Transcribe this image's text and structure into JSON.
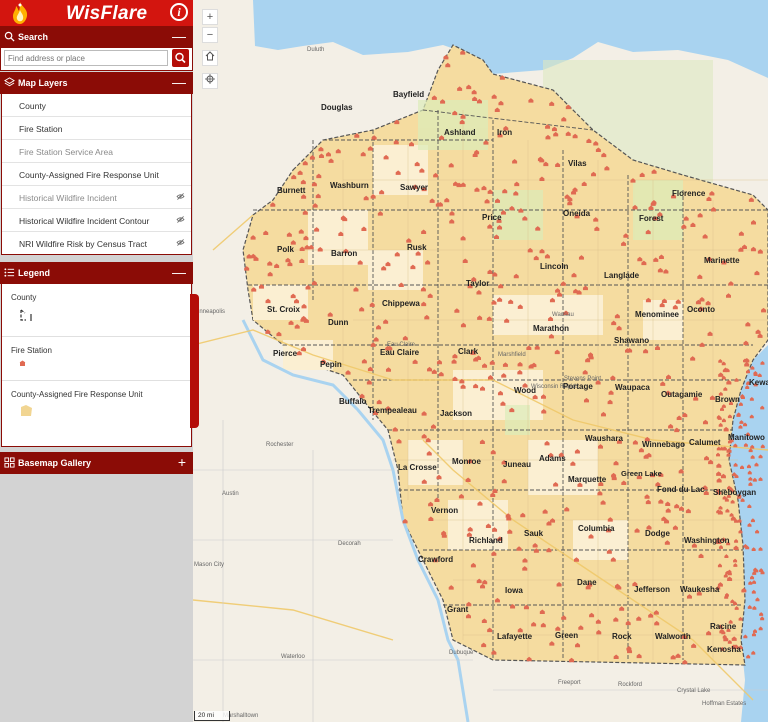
{
  "header": {
    "title": "WisFlare",
    "info_icon": "info-icon",
    "logo_icon": "flame-logo-icon"
  },
  "search": {
    "label": "Search",
    "placeholder": "Find address or place",
    "toggle": "—"
  },
  "map_layers": {
    "label": "Map Layers",
    "toggle": "—",
    "items": [
      {
        "label": "County",
        "visible": true
      },
      {
        "label": "Fire Station",
        "visible": true
      },
      {
        "label": "Fire Station Service Area",
        "visible": false
      },
      {
        "label": "County-Assigned Fire Response Unit",
        "visible": true
      },
      {
        "label": "Historical Wildfire Incident",
        "visible": false
      },
      {
        "label": "Historical Wildfire Incident Contour",
        "visible": false
      },
      {
        "label": "NRI Wildfire Risk by Census Tract",
        "visible": false
      }
    ]
  },
  "legend": {
    "label": "Legend",
    "toggle": "—",
    "items": [
      {
        "title": "County",
        "symbol": "county-outline-swatch"
      },
      {
        "title": "Fire Station",
        "symbol": "fire-station-swatch"
      },
      {
        "title": "County-Assigned Fire Response Unit",
        "symbol": "response-unit-swatch"
      }
    ]
  },
  "basemap": {
    "label": "Basemap Gallery",
    "toggle": "+"
  },
  "map": {
    "zoom_in": "+",
    "zoom_out": "−",
    "scale_label": "20 mi",
    "counties": [
      "Bayfield",
      "Douglas",
      "Ashland",
      "Iron",
      "Vilas",
      "Burnett",
      "Washburn",
      "Sawyer",
      "Price",
      "Oneida",
      "Forest",
      "Florence",
      "Polk",
      "Barron",
      "Rusk",
      "Lincoln",
      "Langlade",
      "Marinette",
      "Taylor",
      "St. Croix",
      "Dunn",
      "Chippewa",
      "Menominee",
      "Oconto",
      "Marathon",
      "Shawano",
      "Pierce",
      "Pepin",
      "Eau Claire",
      "Clark",
      "Kewa",
      "Wood",
      "Portage",
      "Waupaca",
      "Outagamie",
      "Brown",
      "Buffalo",
      "Trempealeau",
      "Jackson",
      "Calumet",
      "Manitowo",
      "Waushara",
      "Winnebago",
      "La Crosse",
      "Monroe",
      "Juneau",
      "Adams",
      "Marquette",
      "Green Lake",
      "Fond du Lac",
      "Sheboygan",
      "Vernon",
      "Richland",
      "Sauk",
      "Columbia",
      "Dodge",
      "Washington",
      "Crawford",
      "Dane",
      "Jefferson",
      "Waukesha",
      "Iowa",
      "Grant",
      "Racine",
      "Lafayette",
      "Green",
      "Rock",
      "Walworth",
      "Kenosha"
    ],
    "places": [
      "Duluth",
      "Rochester",
      "Austin",
      "Decorah",
      "Mason City",
      "Waterloo",
      "Dubuque",
      "Freeport",
      "Rockford",
      "Crystal Lake",
      "Hoffman Estates",
      "Marshalltown",
      "Wausau",
      "Wisconsin Rapids",
      "Marshfield",
      "Eau Claire",
      "Minneapolis",
      "Stevens Point"
    ]
  }
}
